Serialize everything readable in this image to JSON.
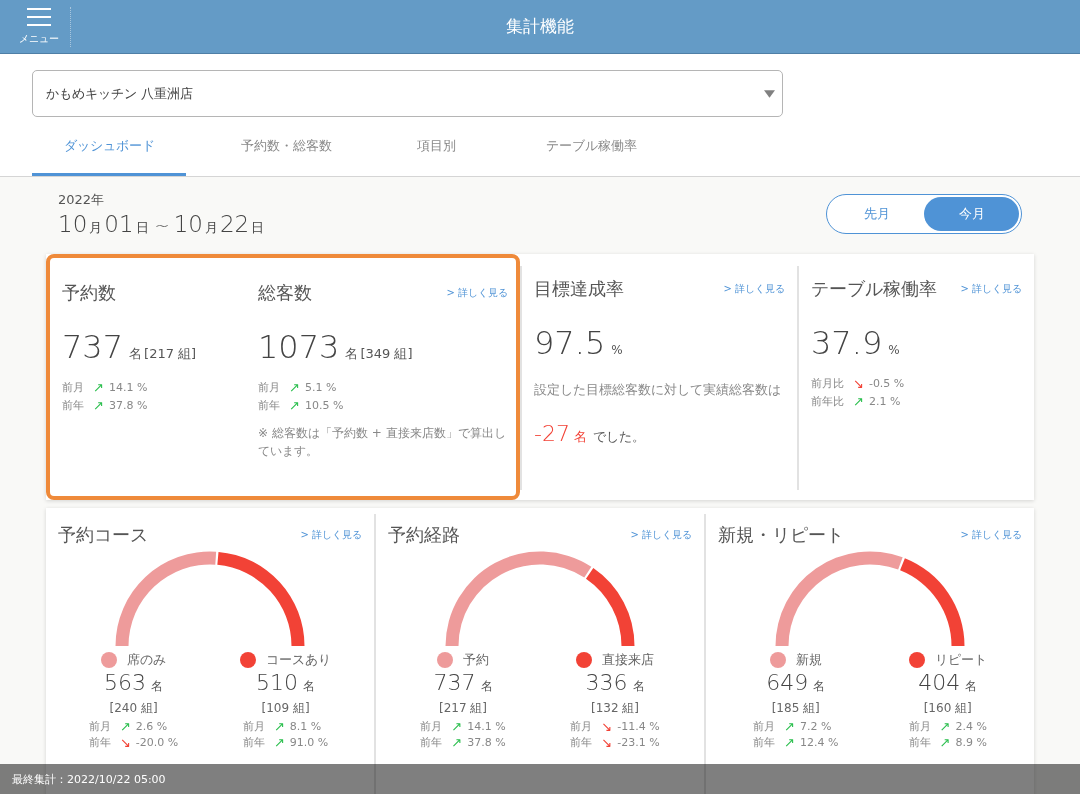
{
  "header": {
    "menu_label": "メニュー",
    "title": "集計機能"
  },
  "store_select": {
    "value": "かもめキッチン 八重洲店"
  },
  "tabs": [
    {
      "label": "ダッシュボード",
      "selected": true
    },
    {
      "label": "予約数・総客数",
      "selected": false
    },
    {
      "label": "項目別",
      "selected": false
    },
    {
      "label": "テーブル稼働率",
      "selected": false
    }
  ],
  "period": {
    "year": "2022年",
    "range": [
      {
        "kind": "num",
        "text": "10"
      },
      {
        "kind": "unit",
        "text": "月"
      },
      {
        "kind": "num",
        "text": "01"
      },
      {
        "kind": "unit",
        "text": "日"
      },
      {
        "kind": "sep",
        "text": "~"
      },
      {
        "kind": "num",
        "text": "10"
      },
      {
        "kind": "unit",
        "text": "月"
      },
      {
        "kind": "num",
        "text": "22"
      },
      {
        "kind": "unit",
        "text": "日"
      }
    ]
  },
  "period_toggle": [
    {
      "label": "先月",
      "selected": false
    },
    {
      "label": "今月",
      "selected": true
    }
  ],
  "summary": {
    "highlighted": true,
    "metrics": [
      {
        "title": "予約数",
        "value": "737",
        "unit": "名",
        "groups": "[217 組]",
        "comparisons": [
          {
            "label": "前月",
            "kind": "up",
            "arrow": "↗",
            "value": "14.1 %"
          },
          {
            "label": "前年",
            "kind": "up",
            "arrow": "↗",
            "value": "37.8 %"
          }
        ]
      },
      {
        "title": "総客数",
        "link": "> 詳しく見る",
        "value": "1073",
        "unit": "名",
        "groups": "[349 組]",
        "comparisons": [
          {
            "label": "前月",
            "kind": "up",
            "arrow": "↗",
            "value": "5.1 %"
          },
          {
            "label": "前年",
            "kind": "up",
            "arrow": "↗",
            "value": "10.5 %"
          }
        ],
        "note": "※ 総客数は「予約数 + 直接来店数」で算出しています。"
      }
    ]
  },
  "goal_achievement": {
    "title": "目標達成率",
    "link": "> 詳しく見る",
    "value": "97.5",
    "unit": "%",
    "description": "設定した目標総客数に対して実績総客数は",
    "result_value": "-27",
    "result_unit": "名",
    "result_suffix": "でした。"
  },
  "table_utilization": {
    "title": "テーブル稼働率",
    "link": "> 詳しく見る",
    "value": "37.9",
    "unit": "%",
    "comparisons": [
      {
        "label": "前月比",
        "kind": "down",
        "arrow": "↘",
        "value": "-0.5 %"
      },
      {
        "label": "前年比",
        "kind": "up",
        "arrow": "↗",
        "value": "2.1 %"
      }
    ]
  },
  "breakdowns": [
    {
      "title": "予約コース",
      "link": "> 詳しく見る",
      "segments": [
        {
          "label": "席のみ",
          "color": "#ee9b9b",
          "count": "563",
          "unit": "名",
          "groups": "[240 組]",
          "comparisons": [
            {
              "label": "前月",
              "kind": "up",
              "arrow": "↗",
              "value": "2.6 %"
            },
            {
              "label": "前年",
              "kind": "down",
              "arrow": "↘",
              "value": "-20.0 %"
            }
          ]
        },
        {
          "label": "コースあり",
          "color": "#f24236",
          "count": "510",
          "unit": "名",
          "groups": "[109 組]",
          "comparisons": [
            {
              "label": "前月",
              "kind": "up",
              "arrow": "↗",
              "value": "8.1 %"
            },
            {
              "label": "前年",
              "kind": "up",
              "arrow": "↗",
              "value": "91.0 %"
            }
          ]
        }
      ]
    },
    {
      "title": "予約経路",
      "link": "> 詳しく見る",
      "segments": [
        {
          "label": "予約",
          "color": "#ee9b9b",
          "count": "737",
          "unit": "名",
          "groups": "[217 組]",
          "comparisons": [
            {
              "label": "前月",
              "kind": "up",
              "arrow": "↗",
              "value": "14.1 %"
            },
            {
              "label": "前年",
              "kind": "up",
              "arrow": "↗",
              "value": "37.8 %"
            }
          ]
        },
        {
          "label": "直接来店",
          "color": "#f24236",
          "count": "336",
          "unit": "名",
          "groups": "[132 組]",
          "comparisons": [
            {
              "label": "前月",
              "kind": "down",
              "arrow": "↘",
              "value": "-11.4 %"
            },
            {
              "label": "前年",
              "kind": "down",
              "arrow": "↘",
              "value": "-23.1 %"
            }
          ]
        }
      ]
    },
    {
      "title": "新規・リピート",
      "link": "> 詳しく見る",
      "segments": [
        {
          "label": "新規",
          "color": "#ee9b9b",
          "count": "649",
          "unit": "名",
          "groups": "[185 組]",
          "comparisons": [
            {
              "label": "前月",
              "kind": "up",
              "arrow": "↗",
              "value": "7.2 %"
            },
            {
              "label": "前年",
              "kind": "up",
              "arrow": "↗",
              "value": "12.4 %"
            }
          ]
        },
        {
          "label": "リピート",
          "color": "#f24236",
          "count": "404",
          "unit": "名",
          "groups": "[160 組]",
          "comparisons": [
            {
              "label": "前月",
              "kind": "up",
              "arrow": "↗",
              "value": "2.4 %"
            },
            {
              "label": "前年",
              "kind": "up",
              "arrow": "↗",
              "value": "8.9 %"
            }
          ]
        }
      ]
    }
  ],
  "status_bar": {
    "text": "最終集計：2022/10/22 05:00"
  }
}
